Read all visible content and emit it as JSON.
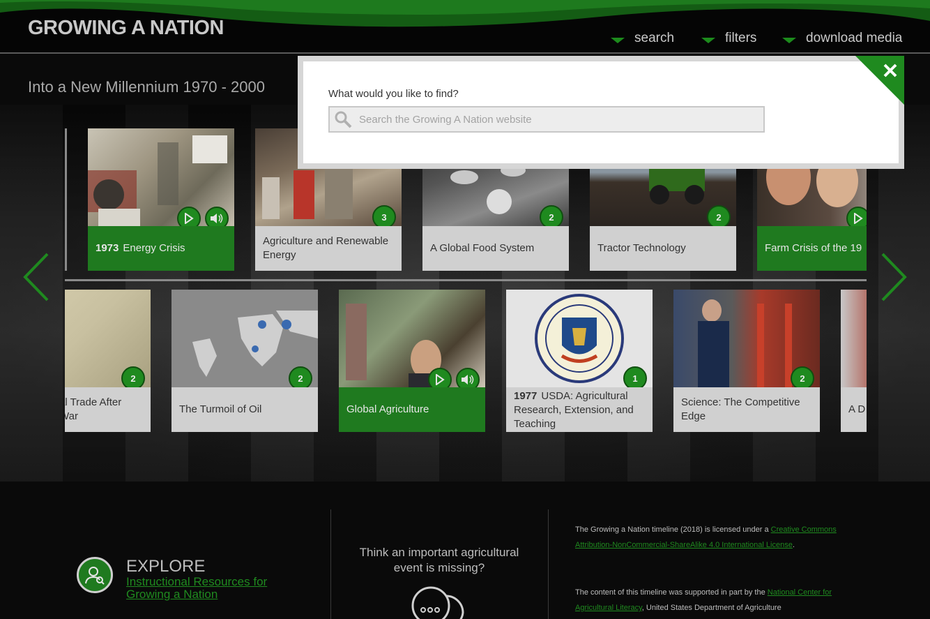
{
  "header": {
    "title": "GROWING A NATION",
    "nav": [
      {
        "label": "search"
      },
      {
        "label": "filters"
      },
      {
        "label": "download media"
      }
    ]
  },
  "era": {
    "title": "Into a New Millennium  1970 - 2000"
  },
  "carousel": {
    "row1": [
      {
        "year": "1973",
        "title": "Energy Crisis",
        "green": true,
        "media": [
          "play-icon",
          "audio-icon"
        ]
      },
      {
        "year": "",
        "title": "Agriculture and Renewable Energy",
        "badge": "3"
      },
      {
        "year": "",
        "title": "A Global Food System",
        "badge": "2"
      },
      {
        "year": "",
        "title": "Tractor Technology",
        "badge": "2"
      },
      {
        "year": "",
        "title": "Farm Crisis of the 19",
        "green": true,
        "media": [
          "play-icon"
        ]
      }
    ],
    "row2": [
      {
        "year": "",
        "title": "al Trade After\nWar",
        "badge": "2"
      },
      {
        "year": "",
        "title": "The Turmoil of Oil",
        "badge": "2"
      },
      {
        "year": "",
        "title": "Global Agriculture",
        "green": true,
        "media": [
          "play-icon",
          "audio-icon"
        ]
      },
      {
        "year": "1977",
        "title": "USDA: Agricultural Research, Extension, and Teaching",
        "badge": "1"
      },
      {
        "year": "",
        "title": "Science: The Competitive Edge",
        "badge": "2"
      },
      {
        "year": "",
        "title": "A D"
      }
    ]
  },
  "search_modal": {
    "prompt": "What would you like to find?",
    "placeholder": "Search the Growing A Nation website"
  },
  "footer": {
    "explore_heading": "EXPLORE",
    "explore_link": "Instructional Resources for Growing a Nation",
    "missing_text": "Think an important agricultural event is missing?",
    "license_prefix": "The Growing a Nation timeline (2018) is licensed under a ",
    "license_link": "Creative Commons Attribution-NonCommercial-ShareAlike 4.0 International License",
    "license_suffix": ".",
    "support_prefix": "The content of this timeline was supported in part by the ",
    "support_link": "National Center for Agricultural Literacy",
    "support_suffix": ", United States Department of Agriculture"
  },
  "colors": {
    "accent": "#1f8a1f",
    "card_label": "#d0d0d0",
    "header_bg": "#050505"
  }
}
